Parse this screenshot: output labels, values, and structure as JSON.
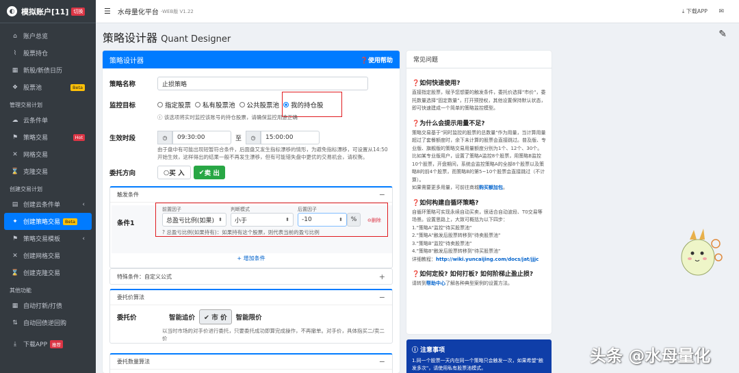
{
  "brand": {
    "title": "模拟账户[11]",
    "switch": "切换"
  },
  "sidebar": {
    "top_items": [
      {
        "label": "账户总览",
        "icon": "dashboard-icon"
      },
      {
        "label": "股票持仓",
        "icon": "chart-icon"
      },
      {
        "label": "新股/新债日历",
        "icon": "calendar-icon"
      },
      {
        "label": "股票池",
        "icon": "pool-icon",
        "badge": "Beta"
      }
    ],
    "section1": "管理交易计划",
    "section1_items": [
      {
        "label": "云条件单",
        "icon": "cloud-icon"
      },
      {
        "label": "策略交易",
        "icon": "strategy-icon",
        "badge": "Hot"
      },
      {
        "label": "网格交易",
        "icon": "grid-icon"
      },
      {
        "label": "克隆交易",
        "icon": "clone-icon"
      }
    ],
    "section2": "创建交易计划",
    "section2_items": [
      {
        "label": "创建云条件单",
        "icon": "cloud-add-icon"
      },
      {
        "label": "创建策略交易",
        "icon": "magic-icon",
        "badge": "Beta"
      },
      {
        "label": "策略交易模板",
        "icon": "template-icon"
      },
      {
        "label": "创建网格交易",
        "icon": "grid-add-icon"
      },
      {
        "label": "创建克隆交易",
        "icon": "clone-add-icon"
      }
    ],
    "section3": "其他功能",
    "section3_items": [
      {
        "label": "自动打新/打债",
        "icon": "calendar-auto-icon"
      },
      {
        "label": "自动回债逆回购",
        "icon": "repo-icon"
      }
    ],
    "download": {
      "label": "下载APP",
      "badge": "推荐"
    }
  },
  "topbar": {
    "title": "水母量化平台",
    "version": "-WEB版 V1.22",
    "download": "下载APP"
  },
  "page": {
    "title": "策略设计器",
    "title_en": "Quant Designer"
  },
  "designer": {
    "header": "策略设计器",
    "help": "使用帮助",
    "name_label": "策略名称",
    "name_value": "止损策略",
    "target_label": "监控目标",
    "target_options": [
      "指定股票",
      "私有股票池",
      "公共股票池",
      "我的持仓股"
    ],
    "target_hint": "该选项将实时监控该账号的持仓股票，请确保监控用途正确",
    "time_label": "生效时段",
    "time_start": "09:30:00",
    "time_to": "至",
    "time_end": "15:00:00",
    "time_hint": "由于盘中有可能出现短暂符合条件，后面盘又发生指标漂移的情形，为避免指标漂移，可设置从14:50开始生效，这样得出的结果一般不再发生漂移，但有可能错失盘中更优的交易机会，请权衡。",
    "direction_label": "委托方向",
    "buy": "买 入",
    "sell": "卖 出",
    "trigger": {
      "header": "触发条件",
      "condition_label": "条件1",
      "front_label": "前置因子",
      "front_value": "总盈亏比例(如果)",
      "mode_label": "判断模式",
      "mode_value": "小于",
      "back_label": "后置因子",
      "back_value": "-10",
      "unit": "%",
      "delete": "删除",
      "hint": "总盈亏比例(如果持有)：如果持有这个股票，则代表当前的盈亏比例",
      "add": "增加条件"
    },
    "special": {
      "header": "特殊条件：自定义公式"
    },
    "price_algo": {
      "header": "委托价算法",
      "label": "委托价",
      "options": [
        "智能追价",
        "市 价",
        "智能限价"
      ],
      "selected": "市 价",
      "hint": "以当时市场的对手价进行委托，只要委托成功即算完成操作，不再撤单。对手价，具体指买二/卖二价"
    },
    "qty_algo": {
      "header": "委托数量算法"
    }
  },
  "faq": {
    "header": "常见问题",
    "items": [
      {
        "q": "如何快速使用?",
        "a": "直接指定股票，赋予您想要的触发条件，委托价选择\"市价\"，委托数量选择\"固定数量\"，打开预授权，其他设置保持默认状态，即可快速建成一个简单的策略监控模型。"
      },
      {
        "q": "为什么会提示用量不足?",
        "a": "策略交易基于\"同时监控的股票的总数量\"作为用量，当计算用量超过了套餐额度时，余下未计算的股票会直接跳过。普及版、专业版、旗舰版的策略交易用量额度分别为1个、12个、30个。比如某专业版用户，设置了策略A监控8个股票，用策略B监控10个股票，开盘期间，系统会监控策略A的全部8个股票以及策略B的前4个股票，而策略B的第5~10个股票会直接跳过（不计算）。",
        "a2": "如果需要更多用量，可前往商城",
        "link": "购买额加包",
        "a3": "。"
      },
      {
        "q": "如何构建自循环策略?",
        "a": "自循环策略可实现永续自动买卖，很适合自动波段、T0交易等场景。设置思路上，大致可概括为以下四步：",
        "steps": [
          "1.\"策略A\"监控\"待买股票池\"",
          "2.\"策略A\"触发后股票转移到\"待卖股票池\"",
          "3.\"策略B\"监控\"待卖股票池\"",
          "4.\"策略B\"触发后股票转移到\"待买股票池\""
        ],
        "detail": "详细教程：",
        "url": "http://wiki.yuncaijing.com/docs/jat/jjjc"
      },
      {
        "q": "如何定投? 如何打板? 如何阶梯止盈止损?",
        "a": "请转到",
        "link": "帮助中心",
        "a2": "了解各种典型案例的设置方法。"
      }
    ]
  },
  "notice": {
    "title": "注意事项",
    "text": "1.同一个股票一天内在同一个策略只会触发一次，如果希望\"触发多次\"，请使用私有股票池模式。"
  },
  "watermark": "头条 @水母量化"
}
